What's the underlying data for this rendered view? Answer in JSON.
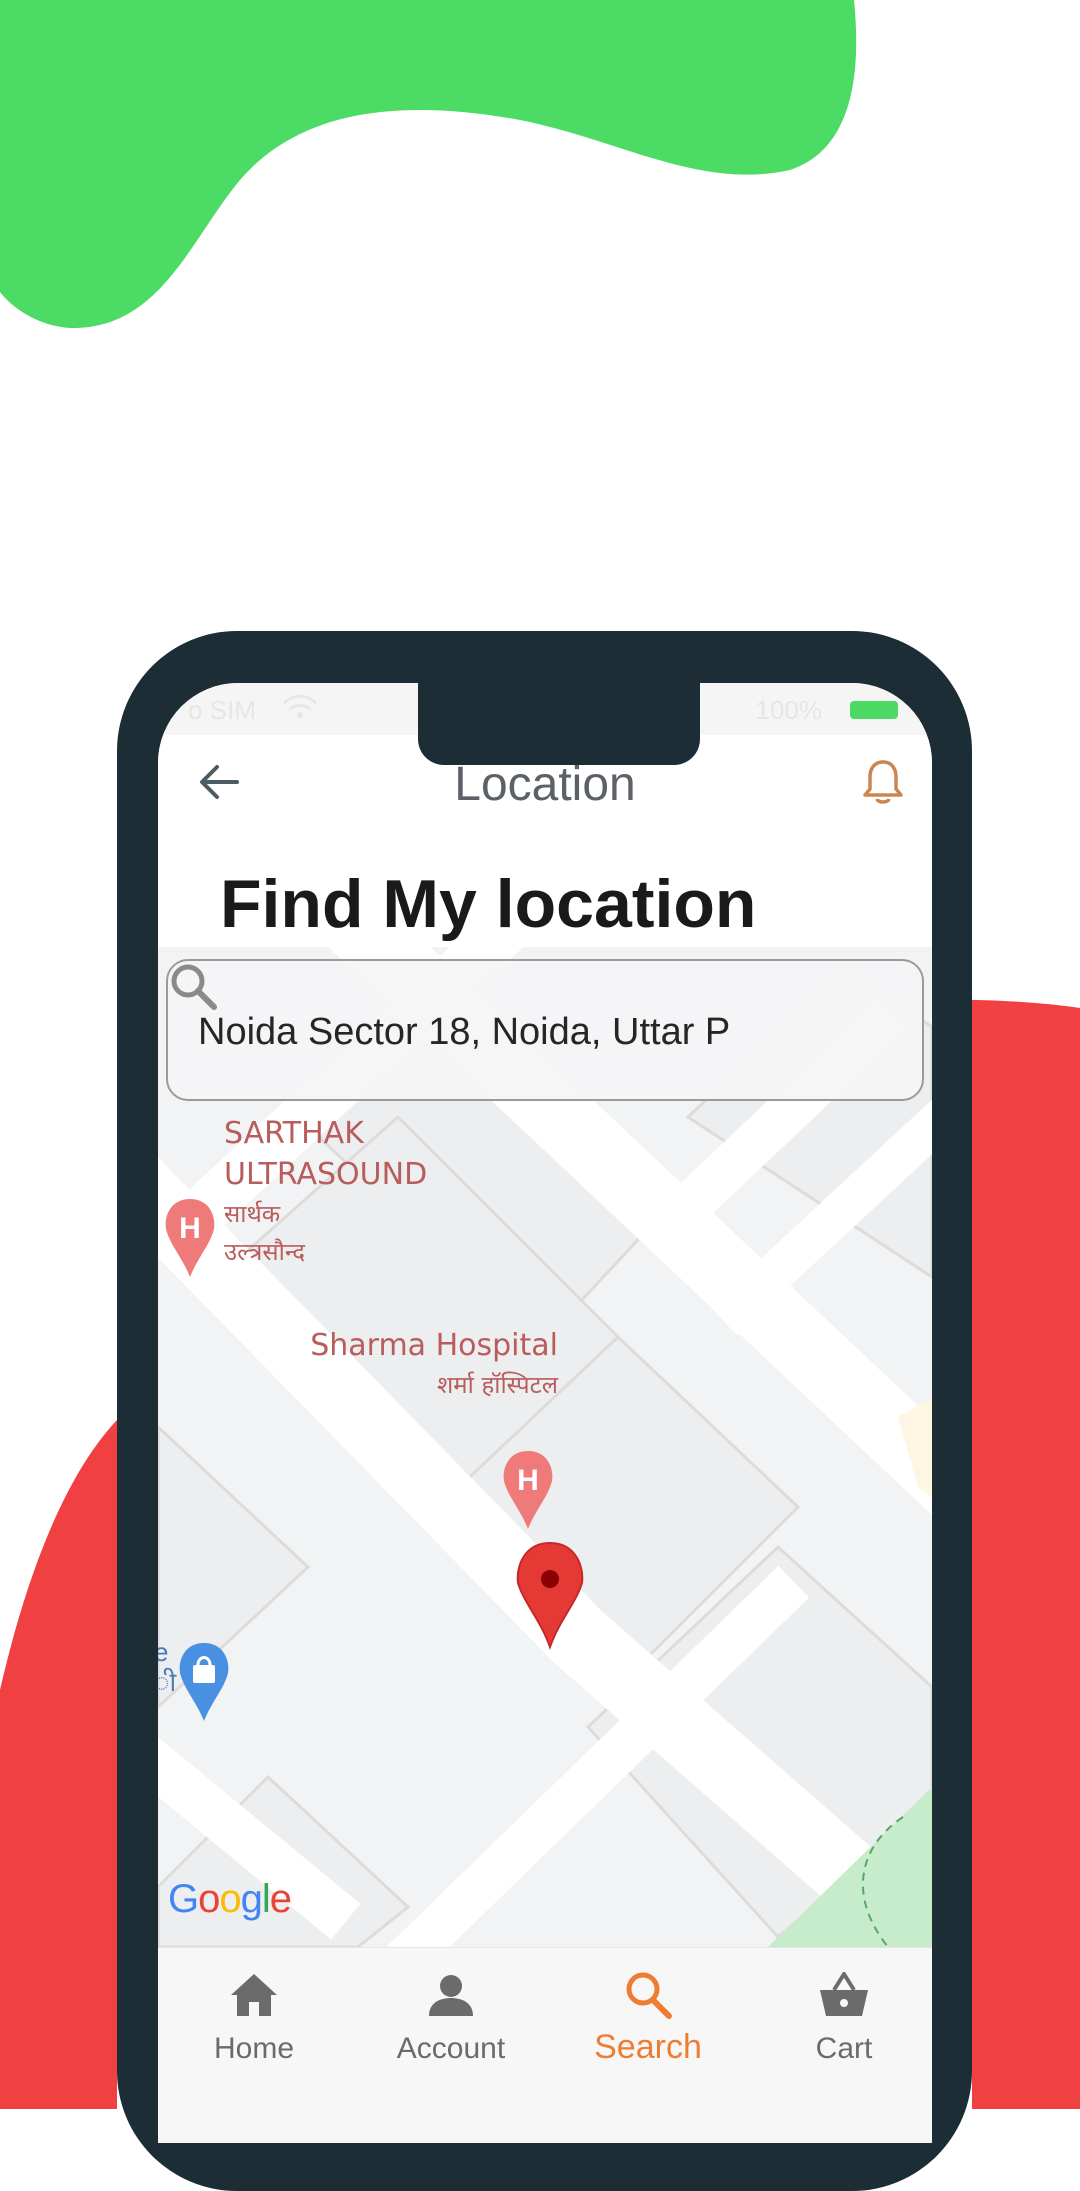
{
  "status_bar": {
    "carrier": "o SIM",
    "battery_text": "100%",
    "battery_color": "#4cd964",
    "wifi_icon": "wifi-icon"
  },
  "header": {
    "title": "Location",
    "back_icon": "arrow-left-icon",
    "bell_icon": "bell-icon",
    "bell_color": "#c98652"
  },
  "page_title": "Find My location",
  "search": {
    "value": "Noida Sector 18, Noida, Uttar P",
    "icon": "search-icon"
  },
  "map": {
    "pois": [
      {
        "name": "SARTHAK ULTRASOUND",
        "line1": "SARTHAK",
        "line2": "ULTRASOUND",
        "hindi1": "सार्थक",
        "hindi2": "उल्त्रसौन्द",
        "icon": "hospital-pin-icon"
      },
      {
        "name": "Sharma Hospital",
        "hindi": "शर्मा हॉस्पिटल",
        "icon": "hospital-pin-icon"
      }
    ],
    "partial_label_1": "e",
    "partial_label_2": "ी",
    "shopping_icon": "shopping-bag-pin-icon",
    "location_pin_icon": "location-pin-icon",
    "attribution": "Google",
    "attribution_letters": [
      "G",
      "o",
      "o",
      "g",
      "l",
      "e"
    ]
  },
  "bottom_nav": {
    "items": [
      {
        "label": "Home",
        "icon": "home-icon",
        "active": false
      },
      {
        "label": "Account",
        "icon": "account-icon",
        "active": false
      },
      {
        "label": "Search",
        "icon": "search-icon",
        "active": true
      },
      {
        "label": "Cart",
        "icon": "cart-icon",
        "active": false
      }
    ],
    "active_color": "#ee7d33",
    "inactive_color": "#6b6b6b"
  },
  "colors": {
    "green_blob": "#4cdb65",
    "red_blob": "#f04042",
    "phone_frame": "#1c2d35"
  }
}
